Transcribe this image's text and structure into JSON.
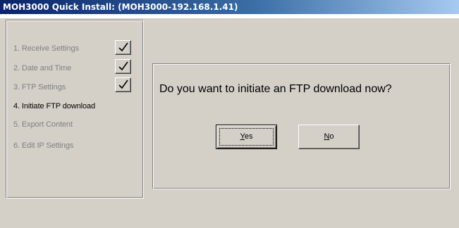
{
  "window": {
    "title": "MOH3000 Quick Install: (MOH3000-192.168.1.41)"
  },
  "steps": [
    {
      "label": "1. Receive Settings",
      "state": "done"
    },
    {
      "label": "2. Date and Time",
      "state": "done"
    },
    {
      "label": "3. FTP Settings",
      "state": "done"
    },
    {
      "label": "4. Initiate FTP download",
      "state": "current"
    },
    {
      "label": "5. Export Content",
      "state": "pending"
    },
    {
      "label": "6. Edit IP Settings",
      "state": "pending"
    }
  ],
  "dialog": {
    "question": "Do you want to initiate an FTP download now?",
    "yes_label": "Yes",
    "yes_mnemonic": "Y",
    "yes_rest": "es",
    "no_label": "No",
    "no_mnemonic": "N",
    "no_rest": "o"
  },
  "colors": {
    "title_start": "#0a246a",
    "title_end": "#a6caf0",
    "face": "#d4d0c8",
    "disabled_text": "#808080",
    "active_text": "#000000"
  },
  "icons": {
    "checkmark": "checkmark-icon"
  }
}
